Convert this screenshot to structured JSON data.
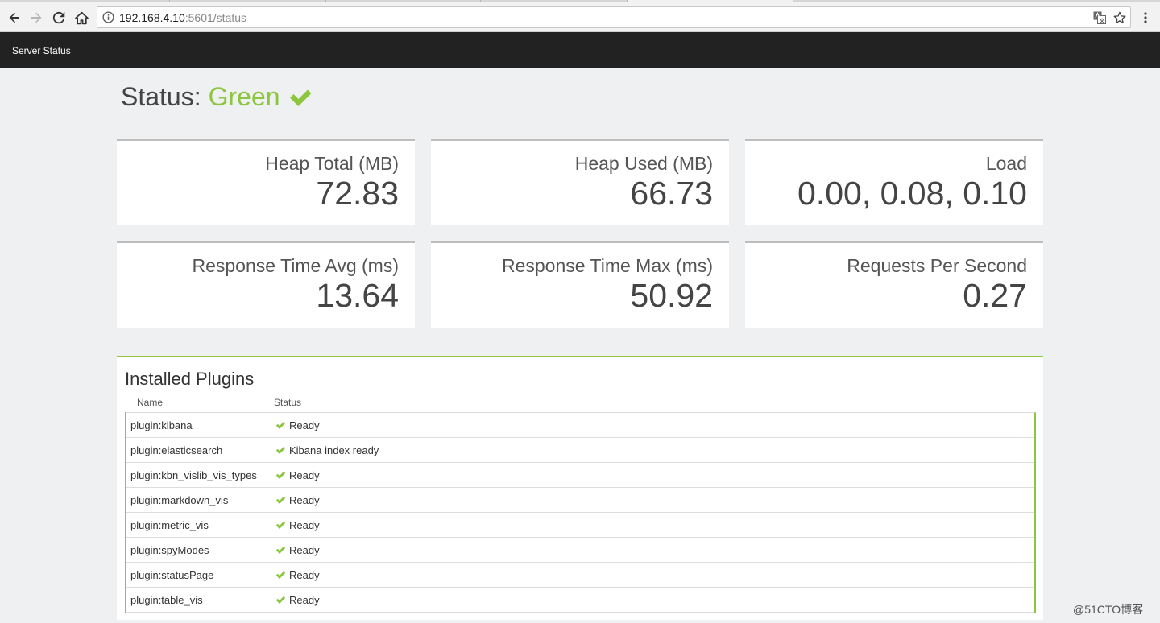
{
  "browser": {
    "url_host": "192.168.4.10",
    "url_rest": ":5601/status"
  },
  "header": {
    "title": "Server Status"
  },
  "status": {
    "prefix": "Status:",
    "state": "Green",
    "state_color": "#8cc63f"
  },
  "metrics": [
    {
      "label": "Heap Total (MB)",
      "value": "72.83"
    },
    {
      "label": "Heap Used (MB)",
      "value": "66.73"
    },
    {
      "label": "Load",
      "value": "0.00, 0.08, 0.10"
    },
    {
      "label": "Response Time Avg (ms)",
      "value": "13.64"
    },
    {
      "label": "Response Time Max (ms)",
      "value": "50.92"
    },
    {
      "label": "Requests Per Second",
      "value": "0.27"
    }
  ],
  "plugins": {
    "title": "Installed Plugins",
    "columns": {
      "name": "Name",
      "status": "Status"
    },
    "rows": [
      {
        "name": "plugin:kibana",
        "status": "Ready"
      },
      {
        "name": "plugin:elasticsearch",
        "status": "Kibana index ready"
      },
      {
        "name": "plugin:kbn_vislib_vis_types",
        "status": "Ready"
      },
      {
        "name": "plugin:markdown_vis",
        "status": "Ready"
      },
      {
        "name": "plugin:metric_vis",
        "status": "Ready"
      },
      {
        "name": "plugin:spyModes",
        "status": "Ready"
      },
      {
        "name": "plugin:statusPage",
        "status": "Ready"
      },
      {
        "name": "plugin:table_vis",
        "status": "Ready"
      }
    ]
  },
  "watermark": "@51CTO博客"
}
